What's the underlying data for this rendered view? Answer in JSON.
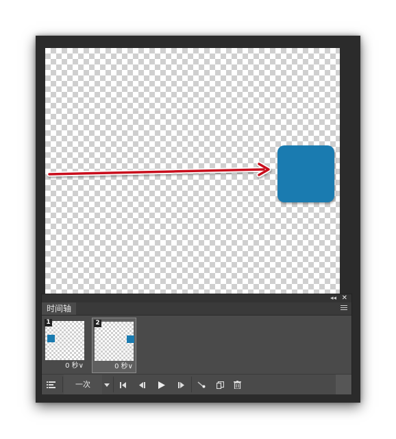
{
  "colors": {
    "square": "#1a7bb0",
    "arrow": "#c8101a",
    "panel_bg": "#4a4a4a",
    "window_bg": "#2b2b2b"
  },
  "panel": {
    "tab_label": "时间轴",
    "collapse_icon": "double-chevron-left-icon",
    "close_icon": "close-icon",
    "menu_icon": "panel-menu-icon"
  },
  "frames": [
    {
      "number": "1",
      "delay": "0 秒∨",
      "selected": false,
      "square_position": "left"
    },
    {
      "number": "2",
      "delay": "0 秒∨",
      "selected": true,
      "square_position": "right"
    }
  ],
  "controls": {
    "convert_icon": "convert-to-video-timeline-icon",
    "loop_label": "一次",
    "loop_dropdown_icon": "triangle-down-icon",
    "first_frame_icon": "first-frame-icon",
    "prev_frame_icon": "previous-frame-icon",
    "play_icon": "play-icon",
    "next_frame_icon": "next-frame-icon",
    "tween_icon": "tween-icon",
    "duplicate_icon": "duplicate-frame-icon",
    "delete_icon": "trash-icon"
  }
}
